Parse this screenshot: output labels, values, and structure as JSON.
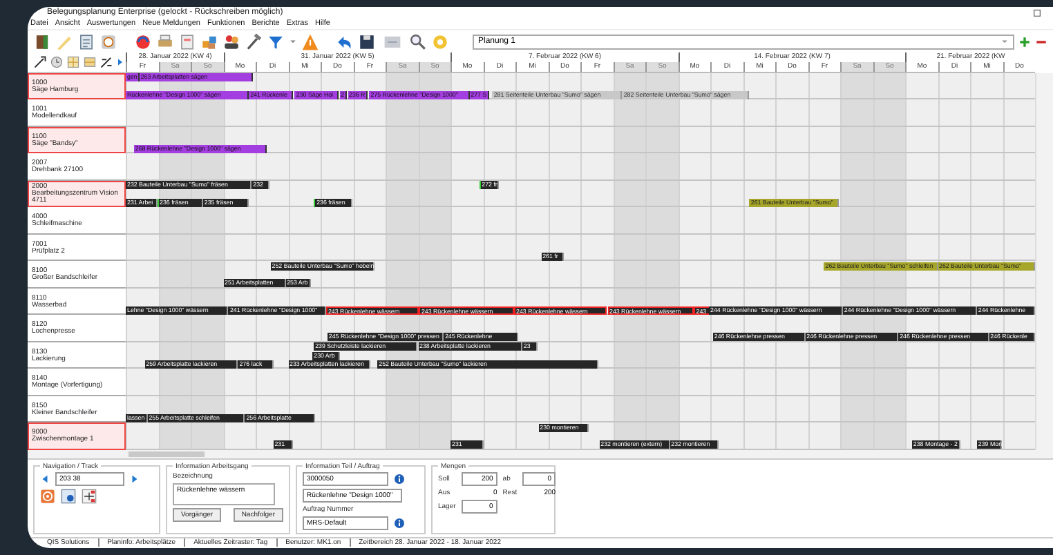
{
  "window": {
    "title": "Belegungsplanung Enterprise (gelockt - Rückschreiben möglich)"
  },
  "menu": [
    "Datei",
    "Ansicht",
    "Auswertungen",
    "Neue Meldungen",
    "Funktionen",
    "Berichte",
    "Extras",
    "Hilfe"
  ],
  "toolbar": {
    "planning_select": "Planung 1"
  },
  "timeline": {
    "weeks": [
      {
        "label": "28. Januar 2022 (KW 4)",
        "days": [
          {
            "label": "Fr",
            "weekend": false
          },
          {
            "label": "Sa",
            "weekend": true
          },
          {
            "label": "So",
            "weekend": true
          }
        ]
      },
      {
        "label": "31. Januar 2022 (KW 5)",
        "days": [
          {
            "label": "Mo",
            "weekend": false
          },
          {
            "label": "Di",
            "weekend": false
          },
          {
            "label": "Mi",
            "weekend": false
          },
          {
            "label": "Do",
            "weekend": false
          },
          {
            "label": "Fr",
            "weekend": false
          },
          {
            "label": "Sa",
            "weekend": true
          },
          {
            "label": "So",
            "weekend": true
          }
        ]
      },
      {
        "label": "7. Februar 2022 (KW 6)",
        "days": [
          {
            "label": "Mo",
            "weekend": false
          },
          {
            "label": "Di",
            "weekend": false
          },
          {
            "label": "Mi",
            "weekend": false
          },
          {
            "label": "Do",
            "weekend": false
          },
          {
            "label": "Fr",
            "weekend": false
          },
          {
            "label": "Sa",
            "weekend": true
          },
          {
            "label": "So",
            "weekend": true
          }
        ]
      },
      {
        "label": "14. Februar 2022 (KW 7)",
        "days": [
          {
            "label": "Mo",
            "weekend": false
          },
          {
            "label": "Di",
            "weekend": false
          },
          {
            "label": "Mi",
            "weekend": false
          },
          {
            "label": "Do",
            "weekend": false
          },
          {
            "label": "Fr",
            "weekend": false
          },
          {
            "label": "Sa",
            "weekend": true
          },
          {
            "label": "So",
            "weekend": true
          }
        ]
      },
      {
        "label": "21. Februar 2022 (KW",
        "days": [
          {
            "label": "Mo",
            "weekend": false
          },
          {
            "label": "Di",
            "weekend": false
          },
          {
            "label": "Mi",
            "weekend": false
          },
          {
            "label": "Do",
            "weekend": false
          }
        ]
      }
    ]
  },
  "resources": [
    {
      "code": "1000",
      "name": "Säge Hamburg",
      "highlighted": true,
      "bars": [
        {
          "label": "gen",
          "kind": "planned"
        },
        {
          "label": "263 Arbeitsplatten sägen",
          "kind": "planned"
        },
        {
          "label": "Rückenlehne \"Design 1000\" sägen",
          "kind": "planned"
        },
        {
          "label": "241 Rückenle",
          "kind": "planned"
        },
        {
          "label": "230 Säge Hol",
          "kind": "planned"
        },
        {
          "label": "2",
          "kind": "planned"
        },
        {
          "label": "236 R",
          "kind": "planned"
        },
        {
          "label": "275 Rückenlehne \"Design 1000\"",
          "kind": "planned"
        },
        {
          "label": "277 S",
          "kind": "planned"
        },
        {
          "label": "281 Seitenteile Unterbau \"Sumo\" sägen",
          "kind": "locked"
        },
        {
          "label": "282 Seitenteile Unterbau \"Sumo\" sägen",
          "kind": "locked"
        }
      ]
    },
    {
      "code": "1001",
      "name": "Modellendkauf",
      "highlighted": false
    },
    {
      "code": "1100",
      "name": "Säge \"Bandsy\"",
      "highlighted": true,
      "bars": [
        {
          "label": "268 Rückenlehne \"Design 1000\" sägen",
          "kind": "planned"
        }
      ]
    },
    {
      "code": "2007",
      "name": "Drehbank 27100",
      "highlighted": false
    },
    {
      "code": "2000",
      "name": "Bearbeitungszentrum Vision 4711",
      "highlighted": true,
      "bars": [
        {
          "label": "232 Bauteile Unterbau \"Sumo\" fräsen",
          "kind": "normal"
        },
        {
          "label": "232",
          "kind": "normal"
        },
        {
          "label": "272 fr",
          "kind": "started"
        },
        {
          "label": "231 Arbei",
          "kind": "normal"
        },
        {
          "label": "236 fräsen",
          "kind": "started"
        },
        {
          "label": "235 fräsen",
          "kind": "normal"
        },
        {
          "label": "236 fräsen",
          "kind": "started"
        },
        {
          "label": "261 Bauteile Unterbau \"Sumo\"",
          "kind": "external"
        }
      ]
    },
    {
      "code": "4000",
      "name": "Schleifmaschine",
      "highlighted": false
    },
    {
      "code": "7001",
      "name": "Prüfplatz 2",
      "highlighted": false,
      "bars": [
        {
          "label": "261 fr",
          "kind": "normal"
        }
      ]
    },
    {
      "code": "8100",
      "name": "Großer Bandschleifer",
      "highlighted": false,
      "bars": [
        {
          "label": "252 Bauteile Unterbau \"Sumo\" hobeln",
          "kind": "normal"
        },
        {
          "label": "262 Bauteile Unterbau \"Sumo\" schleifen",
          "kind": "external"
        },
        {
          "label": "262 Bauteile Unterbau \"Sumo\"",
          "kind": "external"
        },
        {
          "label": "251 Arbeitsplatten",
          "kind": "normal"
        },
        {
          "label": "253 Arb",
          "kind": "normal"
        }
      ]
    },
    {
      "code": "8110",
      "name": "Wasserbad",
      "highlighted": false,
      "bars": [
        {
          "label": "Lehne \"Design 1000\" wässern",
          "kind": "normal"
        },
        {
          "label": "241 Rückenlehne \"Design 1000\"",
          "kind": "normal"
        },
        {
          "label": "243 Rückenlehne wässern",
          "kind": "critical"
        },
        {
          "label": "243 Rückenlehne wässern",
          "kind": "critical"
        },
        {
          "label": "243 Rückenlehne wässern",
          "kind": "critical"
        },
        {
          "label": "243 Rückenlehne wässern",
          "kind": "critical"
        },
        {
          "label": "243",
          "kind": "critical"
        },
        {
          "label": "244 Rückenlehne \"Design 1000\" wässern",
          "kind": "normal"
        },
        {
          "label": "244 Rückenlehne \"Design 1000\" wässern",
          "kind": "normal"
        },
        {
          "label": "244 Rückenlehne",
          "kind": "normal"
        }
      ]
    },
    {
      "code": "8120",
      "name": "Lochenpresse",
      "highlighted": false,
      "bars": [
        {
          "label": "245 Rückenlehne \"Design 1000\" pressen",
          "kind": "normal"
        },
        {
          "label": "245 Rückenlehne",
          "kind": "normal"
        },
        {
          "label": "246 Rückenlehne pressen",
          "kind": "normal"
        },
        {
          "label": "246 Rückenlehne pressen",
          "kind": "normal"
        },
        {
          "label": "246 Rückenlehne pressen",
          "kind": "normal"
        },
        {
          "label": "246 Rückenle",
          "kind": "normal"
        }
      ]
    },
    {
      "code": "8130",
      "name": "Lackierung",
      "highlighted": false,
      "bars": [
        {
          "label": "239 Schutzleiste lackieren",
          "kind": "normal"
        },
        {
          "label": "238 Arbeitsplatte lackieren",
          "kind": "normal"
        },
        {
          "label": "23",
          "kind": "normal"
        },
        {
          "label": "230 Arb",
          "kind": "normal"
        },
        {
          "label": "259 Arbeitsplatte lackieren",
          "kind": "normal"
        },
        {
          "label": "276 lack",
          "kind": "normal"
        },
        {
          "label": "233 Arbeitsplatten lackieren",
          "kind": "normal"
        },
        {
          "label": "252 Bauteile Unterbau \"Sumo\" lackieren",
          "kind": "normal"
        }
      ]
    },
    {
      "code": "8140",
      "name": "Montage (Vorfertigung)",
      "highlighted": false
    },
    {
      "code": "8150",
      "name": "Kleiner Bandschleifer",
      "highlighted": false,
      "bars": [
        {
          "label": "lassen",
          "kind": "normal"
        },
        {
          "label": "255 Arbeitsplatte schleifen",
          "kind": "normal"
        },
        {
          "label": "256 Arbeitsplatte",
          "kind": "normal"
        }
      ]
    },
    {
      "code": "9000",
      "name": "Zwischenmontage 1",
      "highlighted": true,
      "bars": [
        {
          "label": "230 montieren",
          "kind": "normal"
        },
        {
          "label": "231",
          "kind": "normal"
        },
        {
          "label": "231",
          "kind": "normal"
        },
        {
          "label": "232 montieren (extern)",
          "kind": "normal"
        },
        {
          "label": "232 montieren",
          "kind": "normal"
        },
        {
          "label": "238 Montage - 2",
          "kind": "normal"
        },
        {
          "label": "239 Mon",
          "kind": "normal"
        }
      ]
    }
  ],
  "navigation": {
    "title": "Navigation / Track",
    "value": "203 38"
  },
  "operation_info": {
    "title": "Information Arbeitsgang",
    "label": "Bezeichnung",
    "description": "Rückenlehne wässern",
    "buttons": [
      "Vorgänger",
      "Nachfolger"
    ]
  },
  "part_info": {
    "title": "Information Teil / Auftrag",
    "part_number": "3000050",
    "part_name": "Rückenlehne \"Design 1000\"",
    "order_label": "Auftrag Nummer",
    "order_number": "MRS-Default"
  },
  "quantities": {
    "title": "Mengen",
    "fields": [
      {
        "label": "Soll",
        "value": "200",
        "kind": "input"
      },
      {
        "label": "ab",
        "value": "0",
        "kind": "input"
      },
      {
        "label": "Aus",
        "value": "0",
        "kind": "text"
      },
      {
        "label": "Rest",
        "value": "200",
        "kind": "text"
      },
      {
        "label": "Lager",
        "value": "0",
        "kind": "input"
      }
    ]
  },
  "status_bar": [
    "QIS Solutions",
    "Planinfo: Arbeitsplätze",
    "Aktuelles Zeitraster: Tag",
    "Benutzer: MK1.on",
    "Zeitbereich 28. Januar 2022 - 18. Januar 2022"
  ]
}
